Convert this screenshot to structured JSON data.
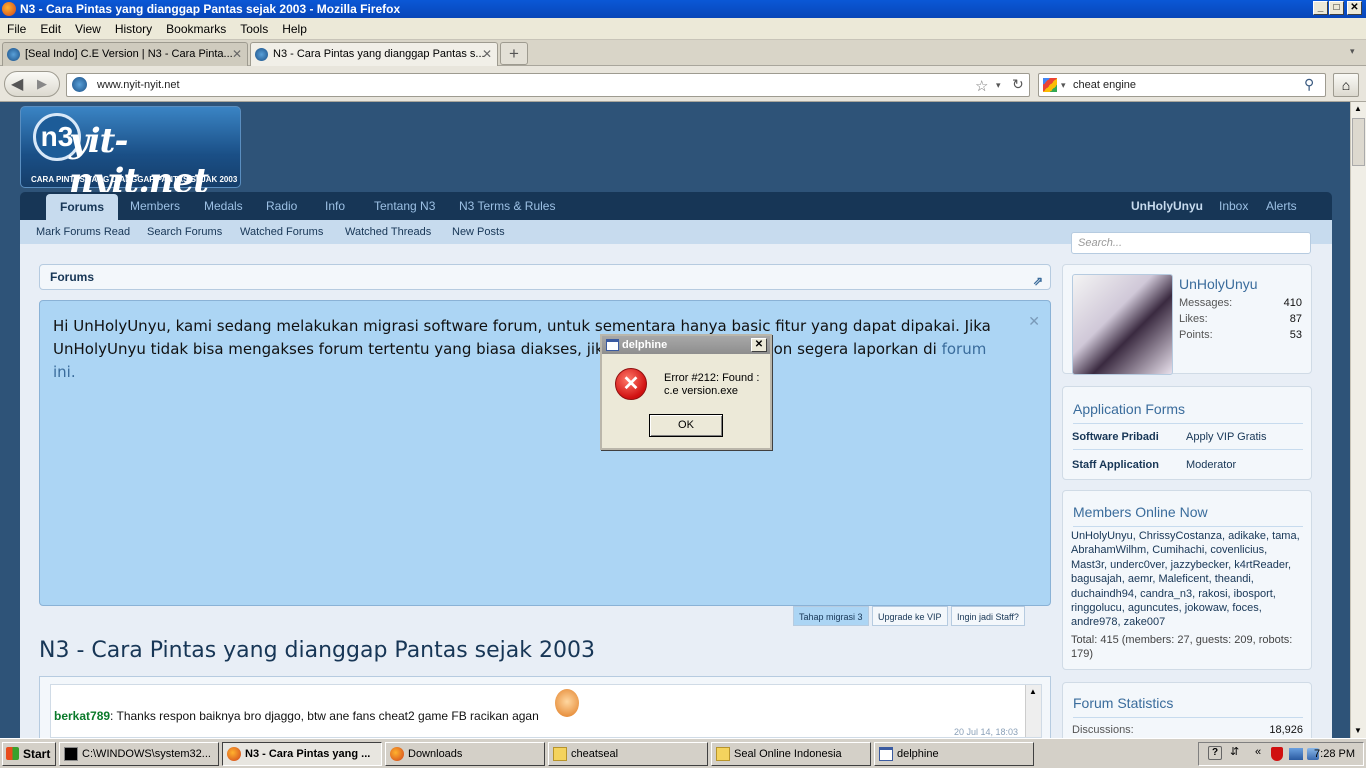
{
  "window": {
    "title": "N3 - Cara Pintas yang dianggap Pantas sejak 2003 - Mozilla Firefox"
  },
  "menu": [
    "File",
    "Edit",
    "View",
    "History",
    "Bookmarks",
    "Tools",
    "Help"
  ],
  "tabs": [
    {
      "label": "[Seal Indo] C.E Version | N3 - Cara Pinta...",
      "active": false
    },
    {
      "label": "N3 - Cara Pintas yang dianggap Pantas s...",
      "active": true
    }
  ],
  "nav": {
    "url": "www.nyit-nyit.net",
    "search_value": "cheat engine"
  },
  "site": {
    "logo_text": "yit-nyit.net",
    "logo_mark": "n3",
    "tagline": "CARA PINTAS YANG DIANGGAP PANTAS SEJAK 2003",
    "nav_tabs": [
      "Forums",
      "Members",
      "Medals",
      "Radio",
      "Info",
      "Tentang N3",
      "N3 Terms & Rules"
    ],
    "user_links": [
      "UnHolyUnyu",
      "Inbox",
      "Alerts"
    ],
    "subnav": [
      "Mark Forums Read",
      "Search Forums",
      "Watched Forums",
      "Watched Threads",
      "New Posts"
    ],
    "breadcrumb": "Forums",
    "notice_text": "Hi UnHolyUnyu, kami sedang melakukan migrasi software forum, untuk sementara hanya basic fitur yang dapat dipakai. Jika UnHolyUnyu tidak bisa mengakses forum tertentu yang biasa diakses, jika ditemukan bug, mohon segera laporkan di",
    "notice_link": "forum ini.",
    "notice_tabs": [
      "Tahap migrasi 3",
      "Upgrade ke VIP",
      "Ingin jadi Staff?"
    ],
    "page_title": "N3 - Cara Pintas yang dianggap Pantas sejak 2003",
    "shout": {
      "user": "berkat789",
      "message": ": Thanks respon baiknya bro djaggo, btw ane fans cheat2 game FB racikan agan",
      "time": "20 Jul 14, 18:03"
    }
  },
  "sidebar": {
    "search_placeholder": "Search...",
    "username": "UnHolyUnyu",
    "stats": [
      {
        "label": "Messages:",
        "value": "410"
      },
      {
        "label": "Likes:",
        "value": "87"
      },
      {
        "label": "Points:",
        "value": "53"
      }
    ],
    "app_forms_title": "Application Forms",
    "app_forms": [
      {
        "name": "Software Pribadi",
        "value": "Apply VIP Gratis"
      },
      {
        "name": "Staff Application",
        "value": "Moderator"
      }
    ],
    "online_title": "Members Online Now",
    "online_members": "UnHolyUnyu, ChrissyCostanza, adikake, tama, AbrahamWilhm, Cumihachi, covenlicius, Mast3r, underc0ver, jazzybecker, k4rtReader, bagusajah, aemr, Maleficent, theandi, duchaindh94, candra_n3, rakosi, ibosport, ringgolucu, aguncutes, jokowaw, foces, andre978, zake007",
    "online_total": "Total: 415 (members: 27, guests: 209, robots: 179)",
    "stats_title": "Forum Statistics",
    "discussions_label": "Discussions:",
    "discussions_value": "18,926"
  },
  "dialog": {
    "title": "delphine",
    "message": "Error #212: Found : c.e version.exe",
    "ok": "OK",
    "error_glyph": "✕"
  },
  "taskbar": {
    "start": "Start",
    "items": [
      {
        "label": "C:\\WINDOWS\\system32...",
        "active": false
      },
      {
        "label": "N3 - Cara Pintas yang ...",
        "active": true
      },
      {
        "label": "Downloads",
        "active": false
      },
      {
        "label": "cheatseal",
        "active": false
      },
      {
        "label": "Seal Online Indonesia",
        "active": false
      },
      {
        "label": "delphine",
        "active": false
      }
    ],
    "clock": "7:28 PM"
  }
}
